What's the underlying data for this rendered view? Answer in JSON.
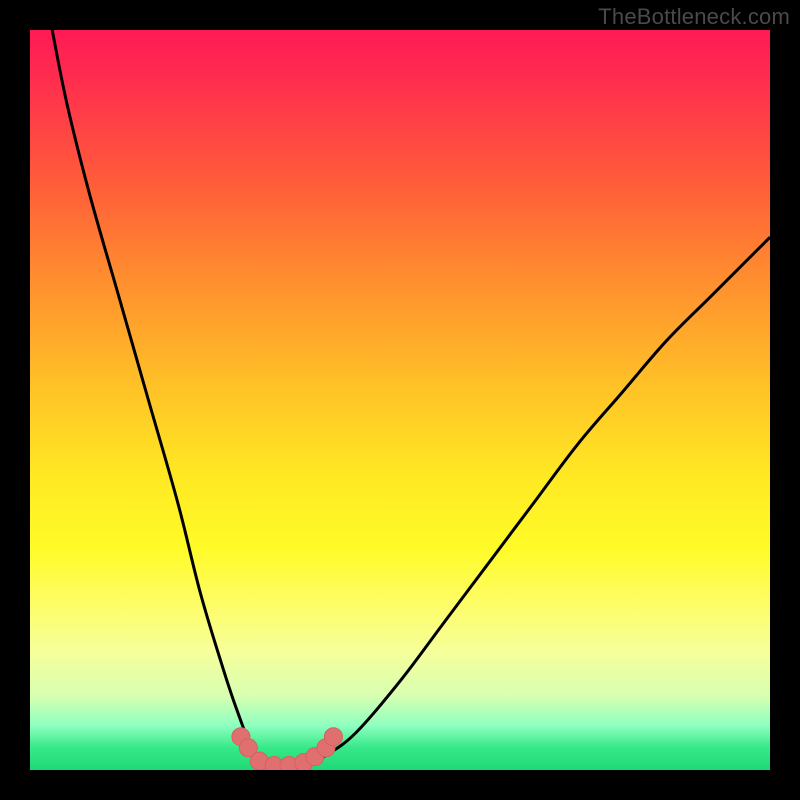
{
  "watermark": {
    "text": "TheBottleneck.com"
  },
  "colors": {
    "frame": "#000000",
    "curve_stroke": "#000000",
    "marker_fill": "#e07070",
    "marker_stroke": "#d85f5f",
    "gradient_top": "#ff1a55",
    "gradient_bottom": "#1fd877"
  },
  "chart_data": {
    "type": "line",
    "title": "",
    "xlabel": "",
    "ylabel": "",
    "xlim": [
      0,
      100
    ],
    "ylim": [
      0,
      100
    ],
    "grid": false,
    "legend": false,
    "series": [
      {
        "name": "bottleneck-curve",
        "x": [
          3,
          5,
          8,
          12,
          16,
          20,
          23,
          26,
          28,
          30,
          32,
          34,
          36,
          38,
          40,
          44,
          50,
          56,
          62,
          68,
          74,
          80,
          86,
          92,
          98,
          100
        ],
        "y": [
          100,
          90,
          78,
          64,
          50,
          36,
          24,
          14,
          8,
          3,
          1,
          0.5,
          0.5,
          1,
          2,
          5,
          12,
          20,
          28,
          36,
          44,
          51,
          58,
          64,
          70,
          72
        ]
      }
    ],
    "markers": [
      {
        "x": 28.5,
        "y": 4.5
      },
      {
        "x": 29.5,
        "y": 3.0
      },
      {
        "x": 31.0,
        "y": 1.2
      },
      {
        "x": 33.0,
        "y": 0.6
      },
      {
        "x": 35.0,
        "y": 0.6
      },
      {
        "x": 37.0,
        "y": 1.0
      },
      {
        "x": 38.5,
        "y": 1.8
      },
      {
        "x": 40.0,
        "y": 3.0
      },
      {
        "x": 41.0,
        "y": 4.5
      }
    ]
  }
}
